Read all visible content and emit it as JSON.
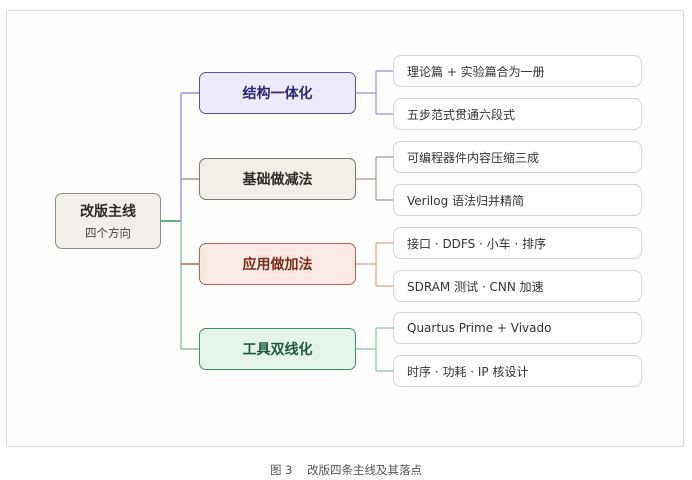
{
  "root": {
    "title": "改版主线",
    "subtitle": "四个方向"
  },
  "branches": [
    {
      "title": "结构一体化",
      "border": "#5b50a6",
      "fill": "#eceafb",
      "line": "#9d8fd6",
      "leaves": [
        "理论篇 + 实验篇合为一册",
        "五步范式贯通六段式"
      ]
    },
    {
      "title": "基础做减法",
      "border": "#7a7670",
      "fill": "#efeee9",
      "line": "#a09c95",
      "leaves": [
        "可编程器件内容压缩三成",
        "Verilog 语法归并精简"
      ]
    },
    {
      "title": "应用做加法",
      "border": "#b5654a",
      "fill": "#fbeae3",
      "line": "#e0a288",
      "leaves": [
        "接口 · DDFS · 小车 · 排序",
        "SDRAM 测试 · CNN 加速"
      ]
    },
    {
      "title": "工具双线化",
      "border": "#3f8f66",
      "fill": "#e4f3ec",
      "line": "#86c4a4",
      "leaves": [
        "Quartus Prime  +  Vivado",
        "时序 · 功耗 · IP 核设计"
      ]
    }
  ],
  "caption": "图 3    改版四条主线及其落点"
}
